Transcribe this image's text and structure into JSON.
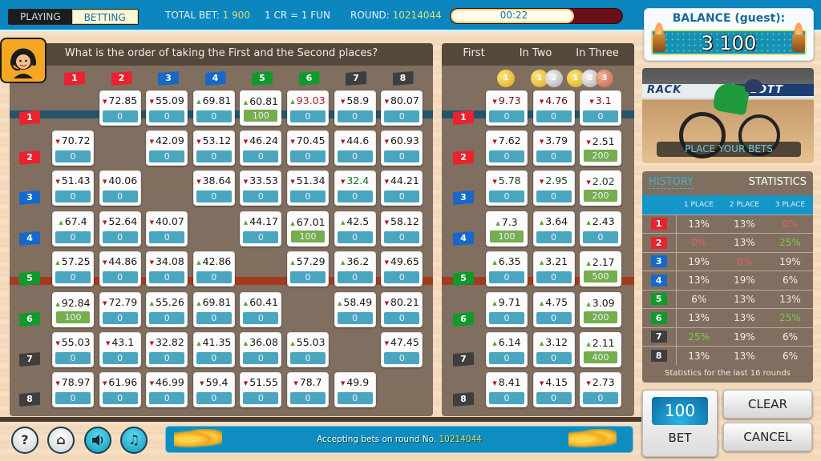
{
  "topbar": {
    "modes": [
      {
        "label": "PLAYING",
        "active": false
      },
      {
        "label": "BETTING",
        "active": true
      }
    ],
    "total_bet_label": "TOTAL BET:",
    "total_bet_value": "1 900",
    "rate": "1 CR = 1 FUN",
    "round_label": "ROUND:",
    "round_value": "10214044",
    "timer": "00:22",
    "timer_progress_pct": 72
  },
  "balance": {
    "label": "BALANCE (guest):",
    "value": "3 100"
  },
  "question": "What is the order of taking the First and the Second places?",
  "flags": [
    {
      "n": "1",
      "color": "red"
    },
    {
      "n": "2",
      "color": "red"
    },
    {
      "n": "3",
      "color": "blue"
    },
    {
      "n": "4",
      "color": "blue"
    },
    {
      "n": "5",
      "color": "green"
    },
    {
      "n": "6",
      "color": "green"
    },
    {
      "n": "7",
      "color": "gray"
    },
    {
      "n": "8",
      "color": "gray"
    }
  ],
  "exacta_grid": [
    [
      null,
      {
        "o": "72.85",
        "d": "down",
        "s": "0"
      },
      {
        "o": "55.09",
        "d": "down",
        "s": "0"
      },
      {
        "o": "69.81",
        "d": "up",
        "s": "0"
      },
      {
        "o": "60.81",
        "d": "up",
        "s": "100"
      },
      {
        "o": "93.03",
        "d": "up",
        "s": "0",
        "c": "red"
      },
      {
        "o": "58.9",
        "d": "down",
        "s": "0"
      },
      {
        "o": "80.07",
        "d": "down",
        "s": "0"
      }
    ],
    [
      {
        "o": "70.72",
        "d": "down",
        "s": "0"
      },
      null,
      {
        "o": "42.09",
        "d": "down",
        "s": "0"
      },
      {
        "o": "53.12",
        "d": "down",
        "s": "0"
      },
      {
        "o": "46.24",
        "d": "down",
        "s": "0"
      },
      {
        "o": "70.45",
        "d": "down",
        "s": "0"
      },
      {
        "o": "44.6",
        "d": "down",
        "s": "0"
      },
      {
        "o": "60.93",
        "d": "down",
        "s": "0"
      }
    ],
    [
      {
        "o": "51.43",
        "d": "down",
        "s": "0"
      },
      {
        "o": "40.06",
        "d": "down",
        "s": "0"
      },
      null,
      {
        "o": "38.64",
        "d": "down",
        "s": "0"
      },
      {
        "o": "33.53",
        "d": "down",
        "s": "0"
      },
      {
        "o": "51.34",
        "d": "down",
        "s": "0"
      },
      {
        "o": "32.4",
        "d": "down",
        "s": "0",
        "c": "green"
      },
      {
        "o": "44.21",
        "d": "down",
        "s": "0"
      }
    ],
    [
      {
        "o": "67.4",
        "d": "up",
        "s": "0"
      },
      {
        "o": "52.64",
        "d": "down",
        "s": "0"
      },
      {
        "o": "40.07",
        "d": "down",
        "s": "0"
      },
      null,
      {
        "o": "44.17",
        "d": "up",
        "s": "0"
      },
      {
        "o": "67.01",
        "d": "up",
        "s": "100"
      },
      {
        "o": "42.5",
        "d": "up",
        "s": "0"
      },
      {
        "o": "58.12",
        "d": "down",
        "s": "0"
      }
    ],
    [
      {
        "o": "57.25",
        "d": "up",
        "s": "0"
      },
      {
        "o": "44.86",
        "d": "down",
        "s": "0"
      },
      {
        "o": "34.08",
        "d": "down",
        "s": "0"
      },
      {
        "o": "42.86",
        "d": "up",
        "s": "0"
      },
      null,
      {
        "o": "57.29",
        "d": "up",
        "s": "0"
      },
      {
        "o": "36.2",
        "d": "up",
        "s": "0"
      },
      {
        "o": "49.65",
        "d": "down",
        "s": "0"
      }
    ],
    [
      {
        "o": "92.84",
        "d": "up",
        "s": "100"
      },
      {
        "o": "72.79",
        "d": "down",
        "s": "0"
      },
      {
        "o": "55.26",
        "d": "up",
        "s": "0"
      },
      {
        "o": "69.81",
        "d": "up",
        "s": "0"
      },
      {
        "o": "60.41",
        "d": "up",
        "s": "0"
      },
      null,
      {
        "o": "58.49",
        "d": "up",
        "s": "0"
      },
      {
        "o": "80.21",
        "d": "down",
        "s": "0"
      }
    ],
    [
      {
        "o": "55.03",
        "d": "down",
        "s": "0"
      },
      {
        "o": "43.1",
        "d": "down",
        "s": "0"
      },
      {
        "o": "32.82",
        "d": "down",
        "s": "0"
      },
      {
        "o": "41.35",
        "d": "up",
        "s": "0"
      },
      {
        "o": "36.08",
        "d": "up",
        "s": "0"
      },
      {
        "o": "55.03",
        "d": "up",
        "s": "0"
      },
      null,
      {
        "o": "47.45",
        "d": "down",
        "s": "0"
      }
    ],
    [
      {
        "o": "78.97",
        "d": "down",
        "s": "0"
      },
      {
        "o": "61.96",
        "d": "down",
        "s": "0"
      },
      {
        "o": "46.99",
        "d": "down",
        "s": "0"
      },
      {
        "o": "59.4",
        "d": "down",
        "s": "0"
      },
      {
        "o": "51.55",
        "d": "down",
        "s": "0"
      },
      {
        "o": "78.7",
        "d": "down",
        "s": "0"
      },
      {
        "o": "49.9",
        "d": "down",
        "s": "0"
      },
      null
    ]
  ],
  "place_headers": [
    "First",
    "In Two",
    "In Three"
  ],
  "place_coins": [
    [
      "1"
    ],
    [
      "1",
      "2"
    ],
    [
      "1",
      "2",
      "3"
    ]
  ],
  "place_grid": [
    [
      {
        "o": "9.73",
        "d": "down",
        "s": "0",
        "c": "darkred"
      },
      {
        "o": "4.76",
        "d": "down",
        "s": "0",
        "c": "darkred"
      },
      {
        "o": "3.1",
        "d": "down",
        "s": "0",
        "c": "darkred"
      }
    ],
    [
      {
        "o": "7.62",
        "d": "down",
        "s": "0"
      },
      {
        "o": "3.79",
        "d": "down",
        "s": "0"
      },
      {
        "o": "2.51",
        "d": "down",
        "s": "200"
      }
    ],
    [
      {
        "o": "5.78",
        "d": "down",
        "s": "0",
        "c": "darkgreen"
      },
      {
        "o": "2.95",
        "d": "down",
        "s": "0",
        "c": "darkgreen"
      },
      {
        "o": "2.02",
        "d": "down",
        "s": "200",
        "c": "darkgreen"
      }
    ],
    [
      {
        "o": "7.3",
        "d": "up",
        "s": "100"
      },
      {
        "o": "3.64",
        "d": "up",
        "s": "0"
      },
      {
        "o": "2.43",
        "d": "up",
        "s": "0"
      }
    ],
    [
      {
        "o": "6.35",
        "d": "up",
        "s": "0"
      },
      {
        "o": "3.21",
        "d": "up",
        "s": "0"
      },
      {
        "o": "2.17",
        "d": "up",
        "s": "500"
      }
    ],
    [
      {
        "o": "9.71",
        "d": "up",
        "s": "0"
      },
      {
        "o": "4.75",
        "d": "up",
        "s": "0"
      },
      {
        "o": "3.09",
        "d": "up",
        "s": "200"
      }
    ],
    [
      {
        "o": "6.14",
        "d": "up",
        "s": "0"
      },
      {
        "o": "3.12",
        "d": "up",
        "s": "0"
      },
      {
        "o": "2.11",
        "d": "up",
        "s": "400"
      }
    ],
    [
      {
        "o": "8.41",
        "d": "down",
        "s": "0"
      },
      {
        "o": "4.15",
        "d": "down",
        "s": "0"
      },
      {
        "o": "2.73",
        "d": "down",
        "s": "0"
      }
    ]
  ],
  "video": {
    "banner_left": "RACK",
    "banner_right": "LOTT",
    "overlay": "PLACE YOUR BETS"
  },
  "stats": {
    "tab_history": "HISTORY",
    "tab_statistics": "STATISTICS",
    "columns": [
      "1 PLACE",
      "2 PLACE",
      "3 PLACE"
    ],
    "rows": [
      {
        "n": "1",
        "color": "red",
        "v": [
          "13%",
          "13%",
          "0%"
        ]
      },
      {
        "n": "2",
        "color": "red",
        "v": [
          "0%",
          "13%",
          "25%"
        ]
      },
      {
        "n": "3",
        "color": "blue",
        "v": [
          "19%",
          "0%",
          "19%"
        ]
      },
      {
        "n": "4",
        "color": "blue",
        "v": [
          "13%",
          "19%",
          "6%"
        ]
      },
      {
        "n": "5",
        "color": "green",
        "v": [
          "6%",
          "13%",
          "13%"
        ]
      },
      {
        "n": "6",
        "color": "green",
        "v": [
          "13%",
          "13%",
          "25%"
        ]
      },
      {
        "n": "7",
        "color": "gray",
        "v": [
          "25%",
          "19%",
          "6%"
        ]
      },
      {
        "n": "8",
        "color": "gray",
        "v": [
          "13%",
          "13%",
          "6%"
        ]
      }
    ],
    "footer": "Statistics for the last 16 rounds"
  },
  "controls": {
    "bet_amount": "100",
    "bet_label": "BET",
    "clear_label": "CLEAR",
    "cancel_label": "CANCEL"
  },
  "bottom_icons": [
    {
      "name": "help-button",
      "glyph": "?",
      "style": "white"
    },
    {
      "name": "home-button",
      "glyph": "⌂",
      "style": "white"
    },
    {
      "name": "sound-button",
      "glyph": "🔈",
      "style": "blue"
    },
    {
      "name": "music-button",
      "glyph": "♫",
      "style": "blue"
    }
  ],
  "status": {
    "text": "Accepting bets on round No. ",
    "round": "10214044"
  },
  "colors": {
    "accent_blue": "#0b86bf",
    "stake_blue": "#4aa6bf",
    "stake_green": "#76ad4f",
    "flag_red": "#e8232f",
    "flag_blue": "#1669c9",
    "flag_green": "#0f9a2c",
    "flag_gray": "#3e3e3e"
  }
}
